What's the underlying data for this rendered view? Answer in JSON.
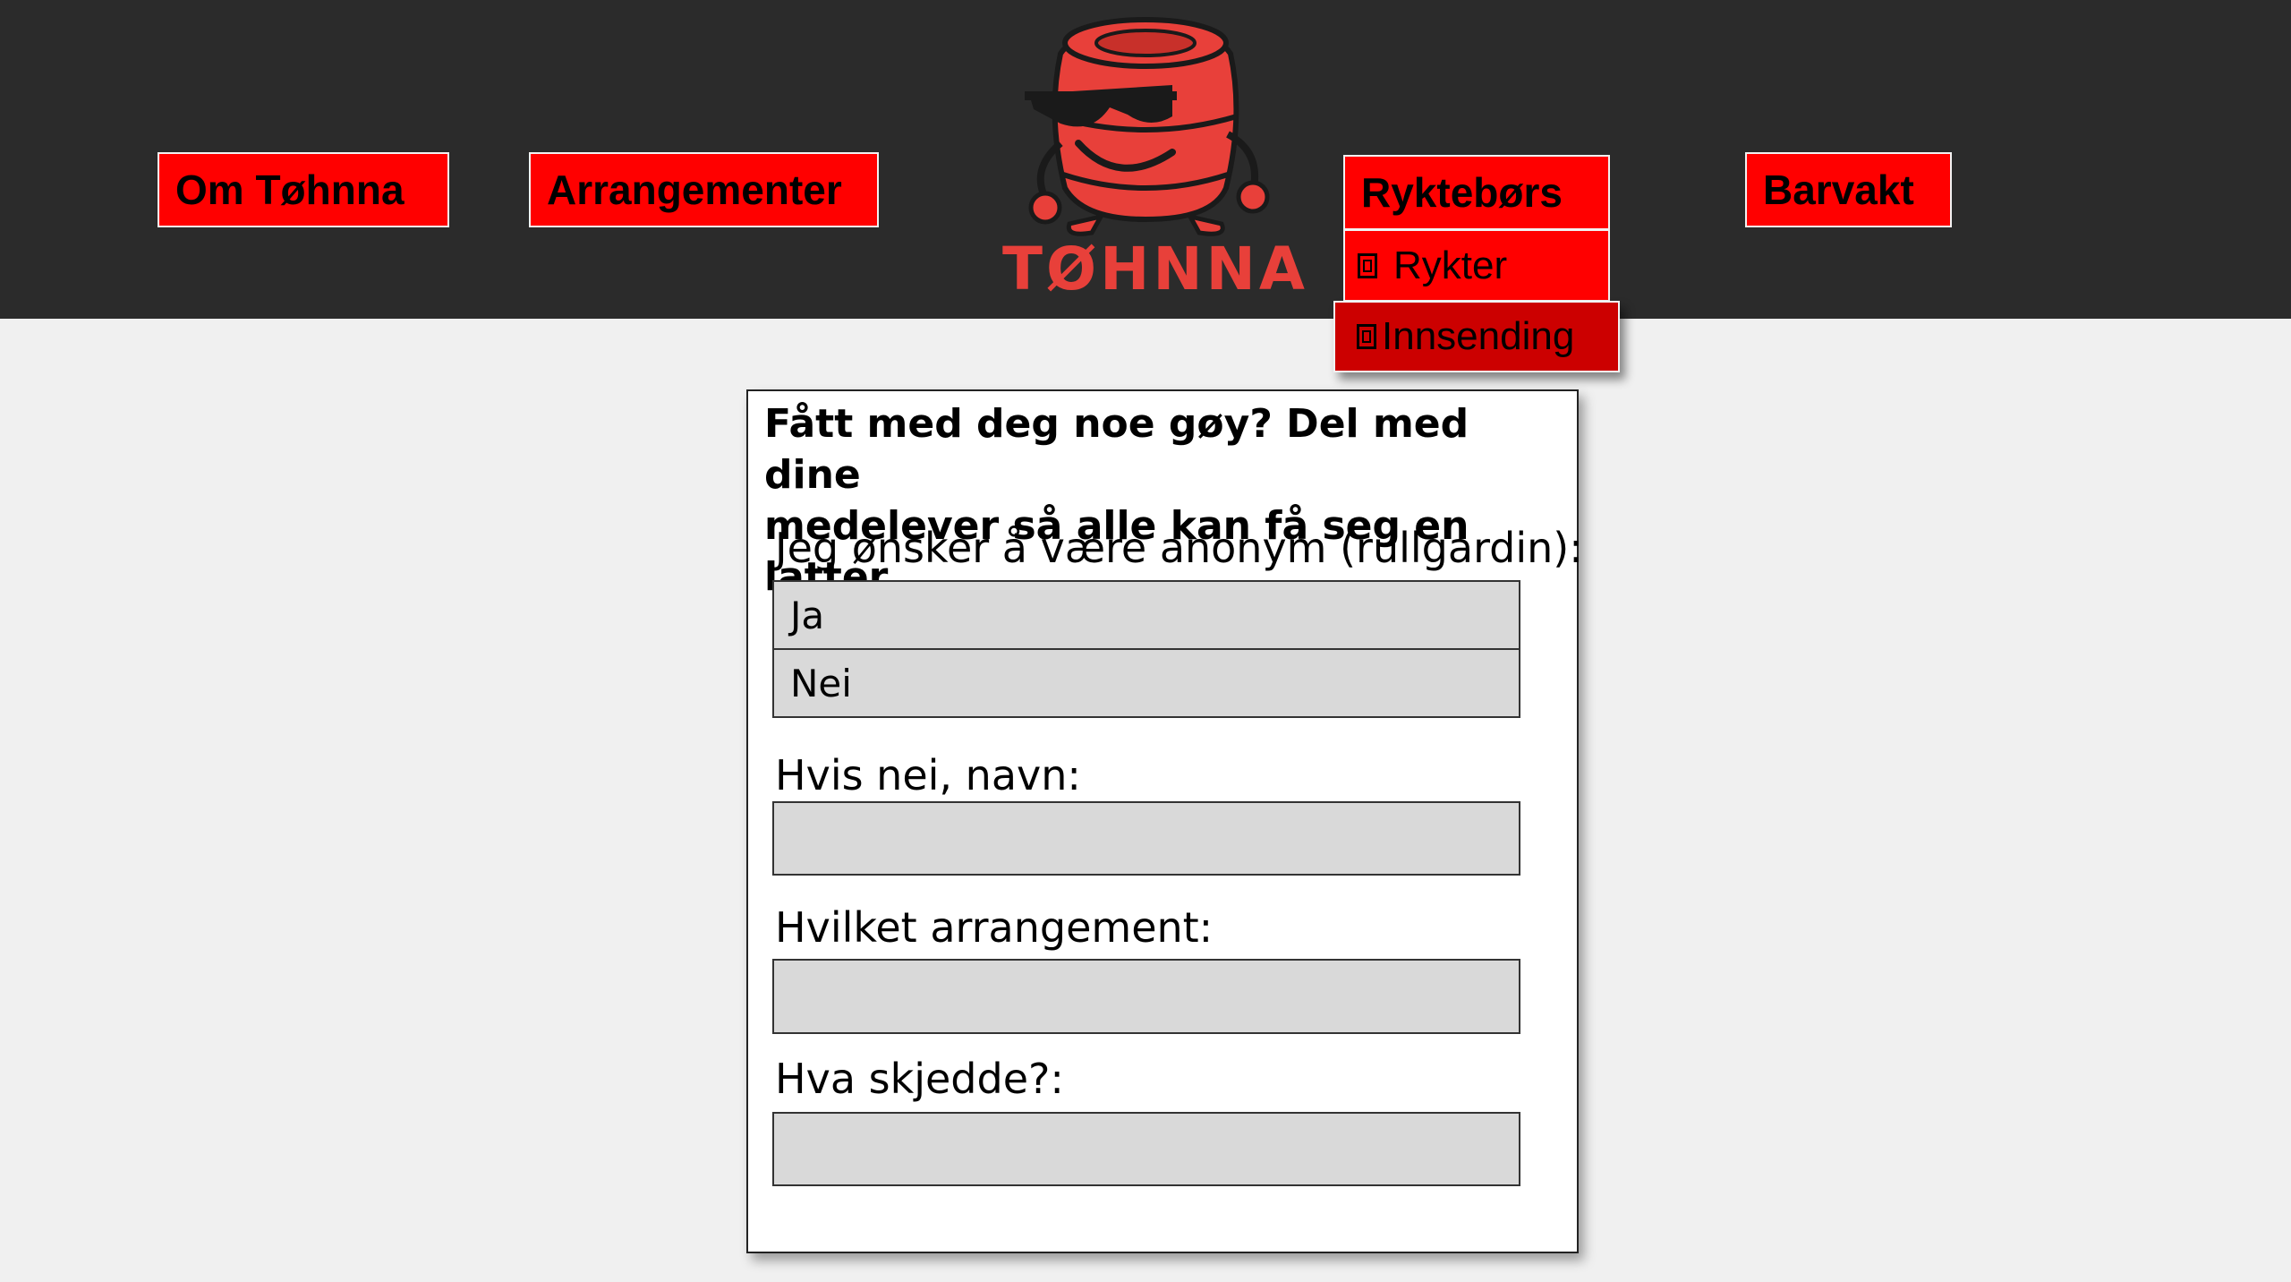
{
  "nav": {
    "om_label": "Om Tøhnna",
    "arrangementer_label": "Arrangementer",
    "ryktebors_label": "Ryktebørs",
    "barvakt_label": "Barvakt",
    "submenu": {
      "rykter_label": "Rykter",
      "innsending_label": "Innsending"
    }
  },
  "logo": {
    "text": "TØHNNA"
  },
  "form": {
    "heading_line1": "Fått med deg noe gøy? Del med dine",
    "heading_line2": "medelever så alle kan få seg en latter",
    "anon_label": "Jeg ønsker å være anonym (rullgardin):",
    "anon_options": [
      "Ja",
      "Nei"
    ],
    "name_label": "Hvis nei, navn:",
    "event_label": "Hvilket arrangement:",
    "what_label": "Hva skjedde?:"
  },
  "colors": {
    "header_bg": "#2b2b2b",
    "nav_red": "#ff0000",
    "active_submenu": "#cc0000",
    "logo_red": "#e8403a",
    "field_gray": "#d9d9d9"
  }
}
